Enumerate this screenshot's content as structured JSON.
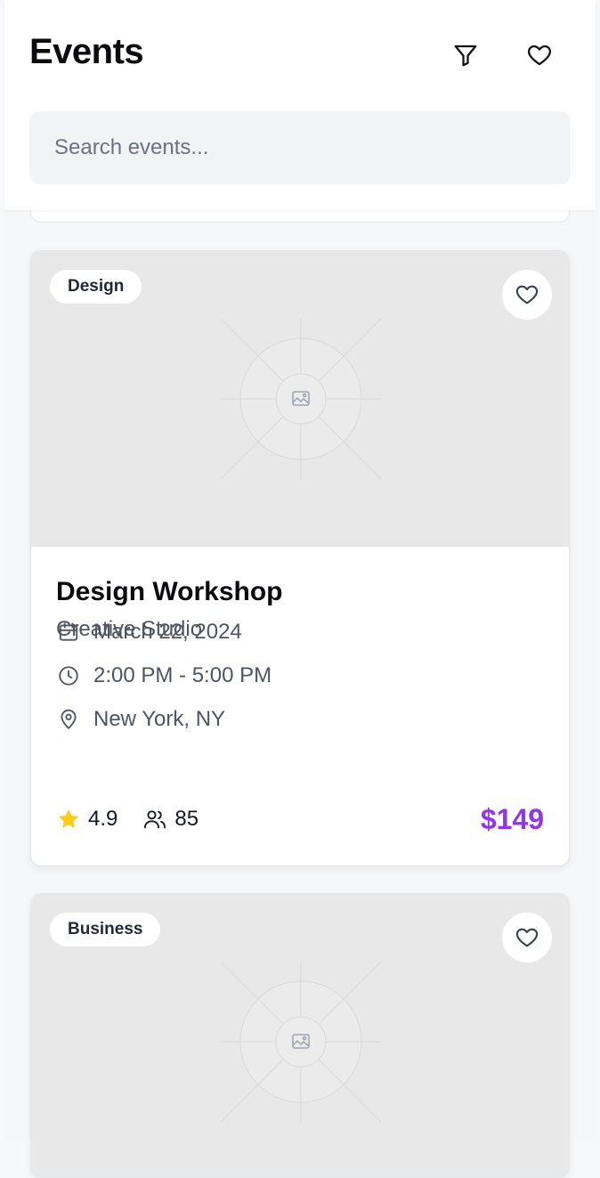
{
  "header": {
    "title": "Events",
    "filter_icon": "filter-icon",
    "favorites_icon": "heart-icon"
  },
  "search": {
    "placeholder": "Search events...",
    "value": ""
  },
  "events": [
    {
      "category": "Design",
      "title": "Design Workshop",
      "organizer": "Creative Studio",
      "date": "March 22, 2024",
      "time": "2:00 PM - 5:00 PM",
      "location": "New York, NY",
      "rating": "4.9",
      "attendees": "85",
      "price": "$149"
    },
    {
      "category": "Business"
    }
  ],
  "colors": {
    "accent_price": "#9333ea",
    "star": "#facc15",
    "image_placeholder_bg": "#e8e8e8"
  }
}
